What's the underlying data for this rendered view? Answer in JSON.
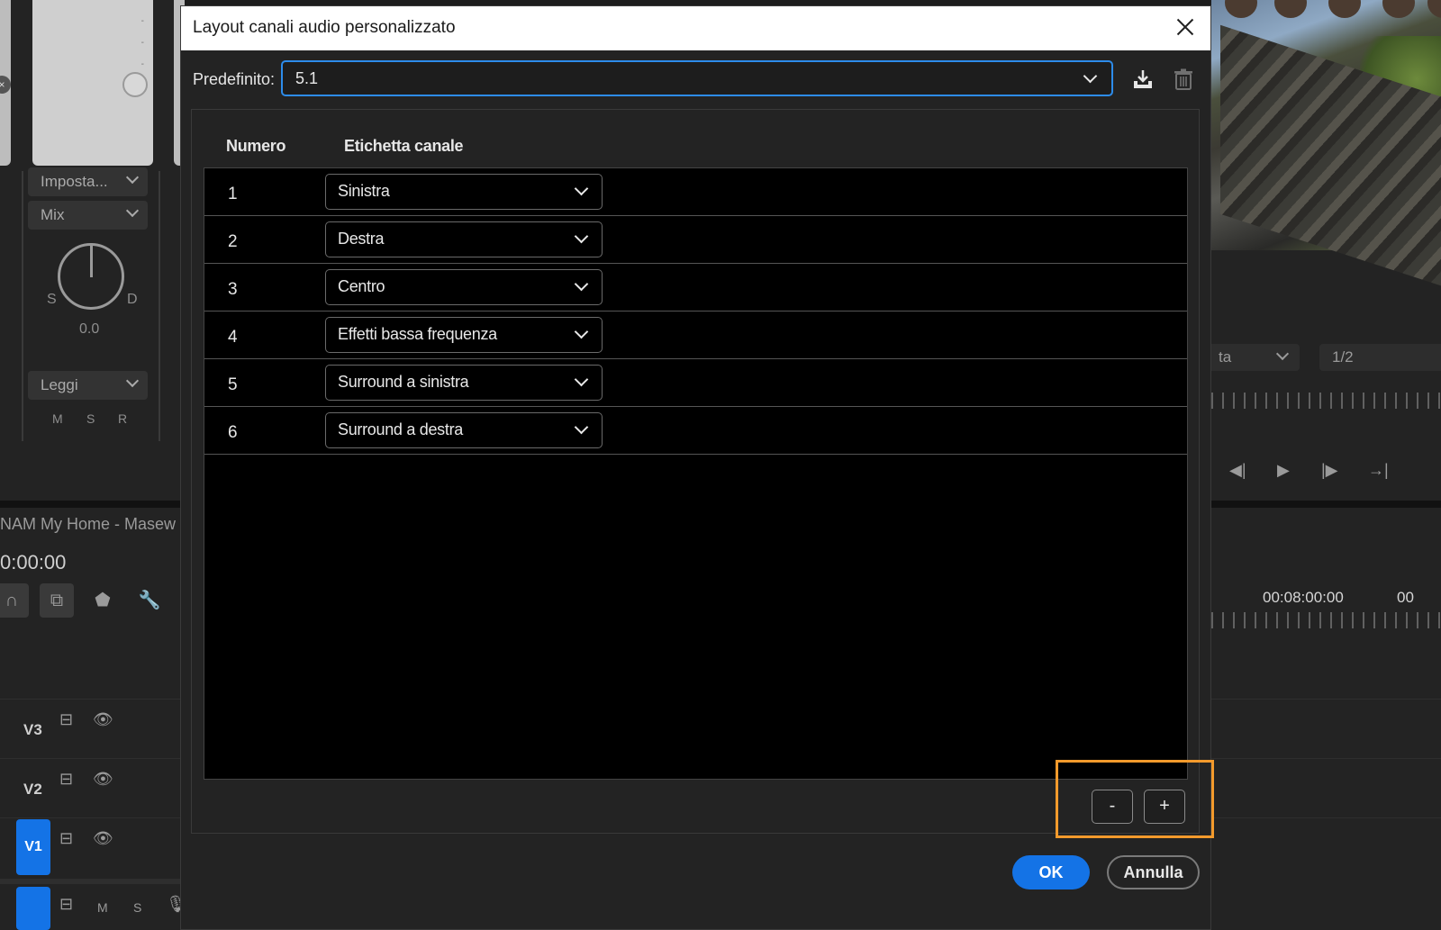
{
  "background_left": {
    "mixer_dropdowns": [
      {
        "label": "Imposta..."
      },
      {
        "label": "Mix"
      },
      {
        "label": "Leggi"
      }
    ],
    "pan_left": "S",
    "pan_right": "D",
    "pan_value": "0.0",
    "msr": [
      "M",
      "S",
      "R"
    ],
    "sequence_title": "NAM   My Home - Masew",
    "timecode": "0:00:00",
    "tracks": [
      "V3",
      "V2",
      "V1"
    ],
    "audio_track_controls": [
      "M",
      "S"
    ]
  },
  "background_right": {
    "zoom_dropdown": "ta",
    "resolution": "1/2",
    "timecode": "00:08:00:00",
    "timecode_cut": "00"
  },
  "dialog": {
    "title": "Layout canali audio personalizzato",
    "preset_label": "Predefinito:",
    "preset_value": "5.1",
    "columns": {
      "number": "Numero",
      "label": "Etichetta canale"
    },
    "channels": [
      {
        "number": "1",
        "label": "Sinistra"
      },
      {
        "number": "2",
        "label": "Destra"
      },
      {
        "number": "3",
        "label": "Centro"
      },
      {
        "number": "4",
        "label": "Effetti bassa frequenza"
      },
      {
        "number": "5",
        "label": "Surround a sinistra"
      },
      {
        "number": "6",
        "label": "Surround a destra"
      }
    ],
    "remove_label": "-",
    "add_label": "+",
    "ok_label": "OK",
    "cancel_label": "Annulla"
  },
  "colors": {
    "accent": "#1473e6",
    "focus": "#2d8ceb",
    "highlight": "#f39a2c"
  }
}
